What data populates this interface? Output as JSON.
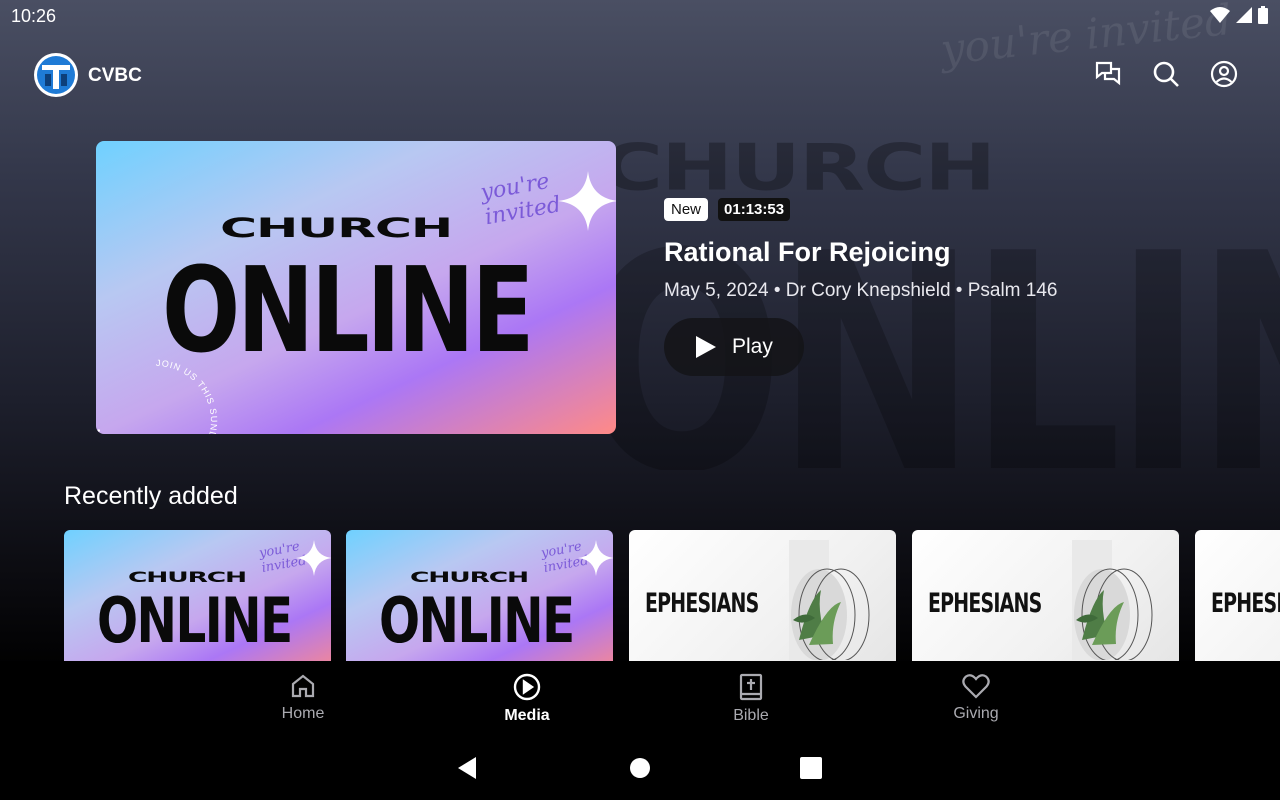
{
  "status_bar": {
    "time": "10:26",
    "icons": [
      "wifi-icon",
      "signal-icon",
      "battery-icon"
    ]
  },
  "app_bar": {
    "name": "CVBC",
    "actions": [
      "chat-icon",
      "search-icon",
      "account-icon"
    ]
  },
  "hero": {
    "art": {
      "script": "you're invited",
      "line1": "CHURCH",
      "line2": "ONLINE",
      "ring_text": "JOIN US THIS SUNDAY • JOIN US THIS SUNDAY •"
    },
    "badge_new": "New",
    "duration": "01:13:53",
    "title": "Rational For Rejoicing",
    "meta": "May 5, 2024 • Dr Cory Knepshield • Psalm 146",
    "play_label": "Play"
  },
  "recent": {
    "title": "Recently added",
    "cards": [
      {
        "type": "online",
        "script": "you're invited",
        "line1": "CHURCH",
        "line2": "ONLINE"
      },
      {
        "type": "online",
        "script": "you're invited",
        "line1": "CHURCH",
        "line2": "ONLINE"
      },
      {
        "type": "ephesians",
        "title": "EPHESIANS"
      },
      {
        "type": "ephesians",
        "title": "EPHESIANS"
      },
      {
        "type": "ephesians",
        "title": "EPHESIANS"
      }
    ]
  },
  "bottom_nav": {
    "items": [
      {
        "label": "Home",
        "icon": "home-icon",
        "active": false
      },
      {
        "label": "Media",
        "icon": "play-circle-icon",
        "active": true
      },
      {
        "label": "Bible",
        "icon": "bible-icon",
        "active": false
      },
      {
        "label": "Giving",
        "icon": "heart-icon",
        "active": false
      }
    ]
  },
  "system_nav": [
    "back-icon",
    "home-circle-icon",
    "recents-icon"
  ],
  "colors": {
    "accent_gradient_start": "#6fd1ff",
    "accent_gradient_mid": "#ab77f5",
    "accent_gradient_end": "#ff8a86",
    "logo_blue": "#1f7bd6"
  }
}
